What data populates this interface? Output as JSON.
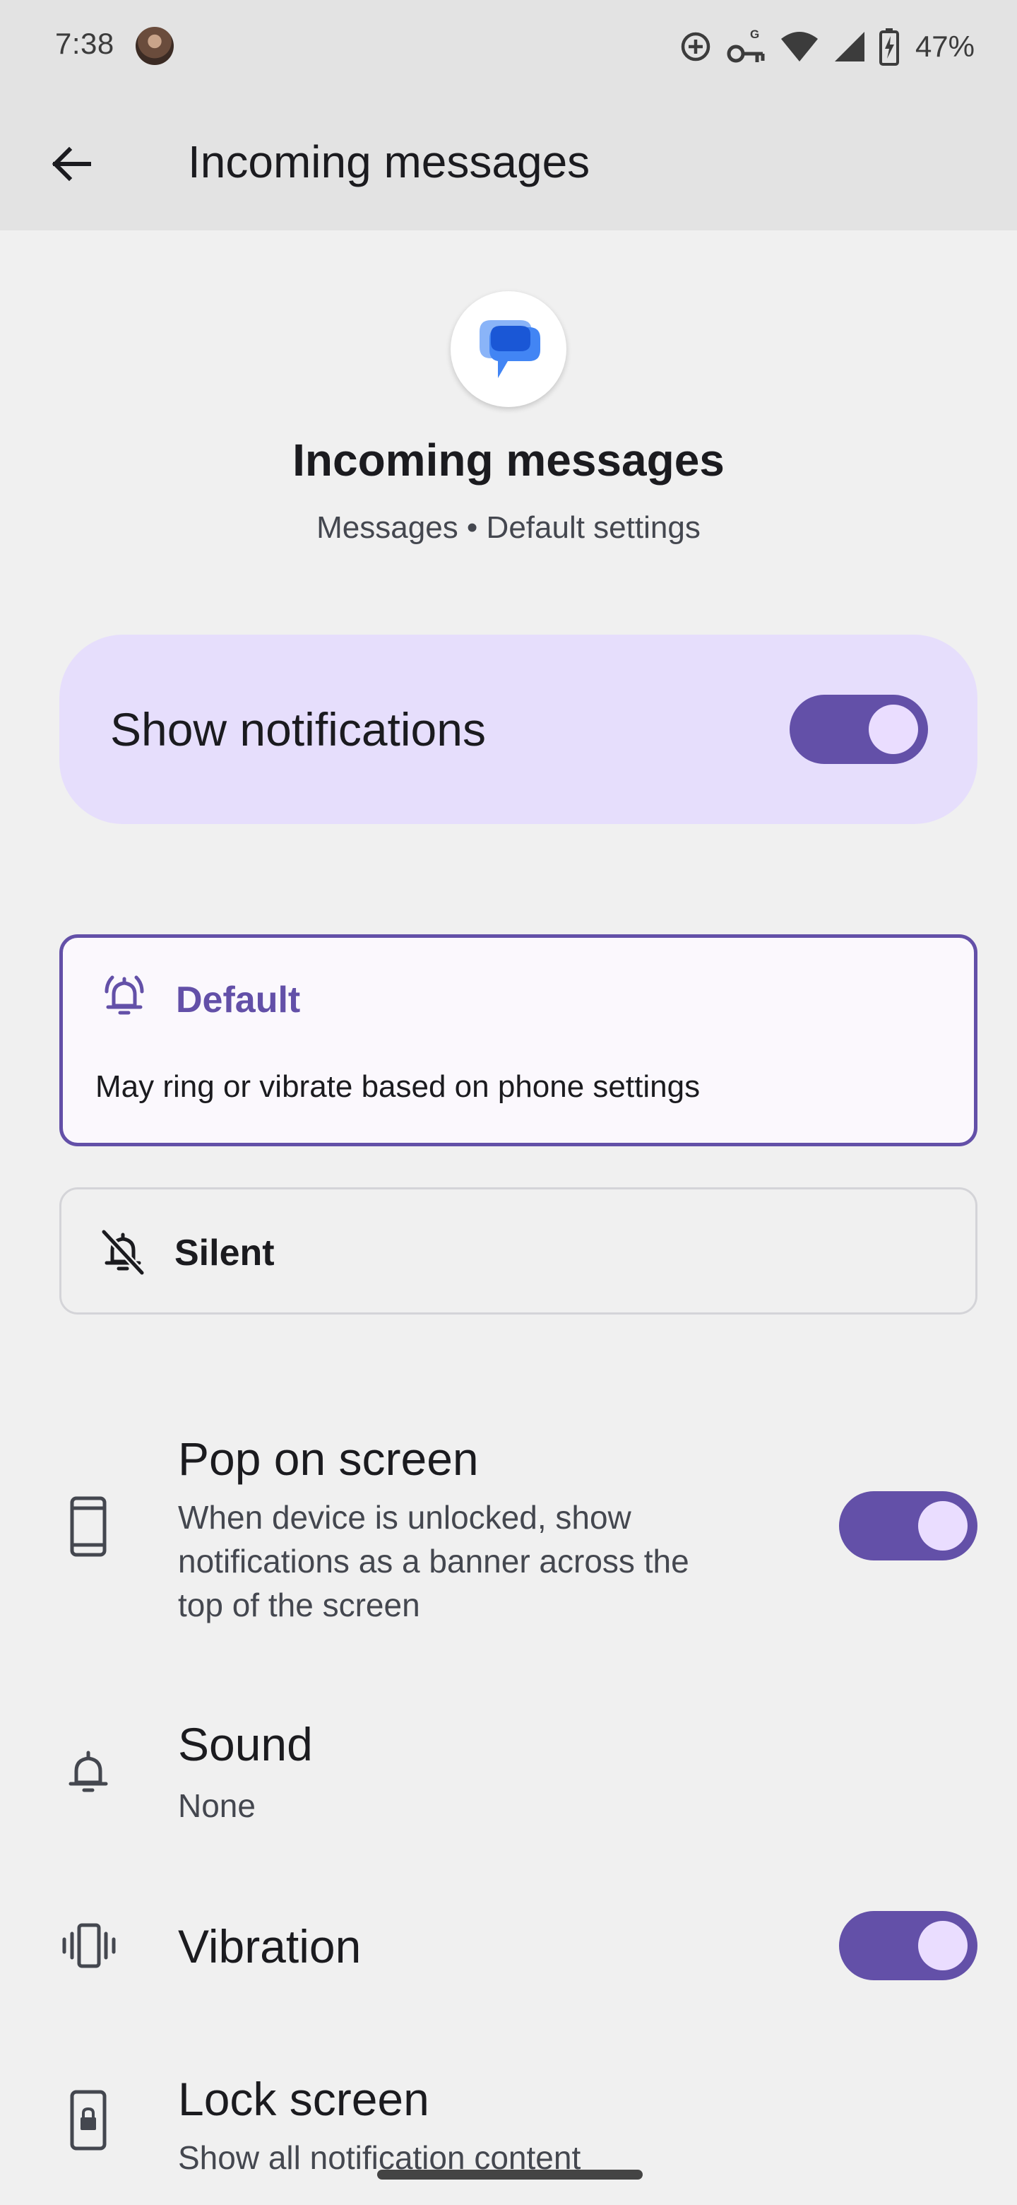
{
  "status_bar": {
    "time": "7:38",
    "battery_percent": "47%"
  },
  "app_bar": {
    "title": "Incoming messages"
  },
  "header": {
    "title": "Incoming messages",
    "subtitle": "Messages • Default settings"
  },
  "main_toggle": {
    "label": "Show notifications",
    "on": true
  },
  "behavior_options": {
    "default": {
      "title": "Default",
      "description": "May ring or vibrate based on phone settings",
      "selected": true
    },
    "silent": {
      "title": "Silent",
      "selected": false
    }
  },
  "settings": {
    "pop_on_screen": {
      "title": "Pop on screen",
      "subtitle_lines": [
        "When device is unlocked, show",
        "notifications as a banner across the",
        "top of the screen"
      ],
      "on": true
    },
    "sound": {
      "title": "Sound",
      "value": "None"
    },
    "vibration": {
      "title": "Vibration",
      "on": true
    },
    "lock_screen": {
      "title": "Lock screen",
      "value": "Show all notification content"
    }
  },
  "colors": {
    "accent": "#6350a8",
    "accent_container": "#e6defc",
    "toggle_knob": "#eaddff",
    "background": "#f0f0f0",
    "app_bar": "#e3e3e3"
  }
}
